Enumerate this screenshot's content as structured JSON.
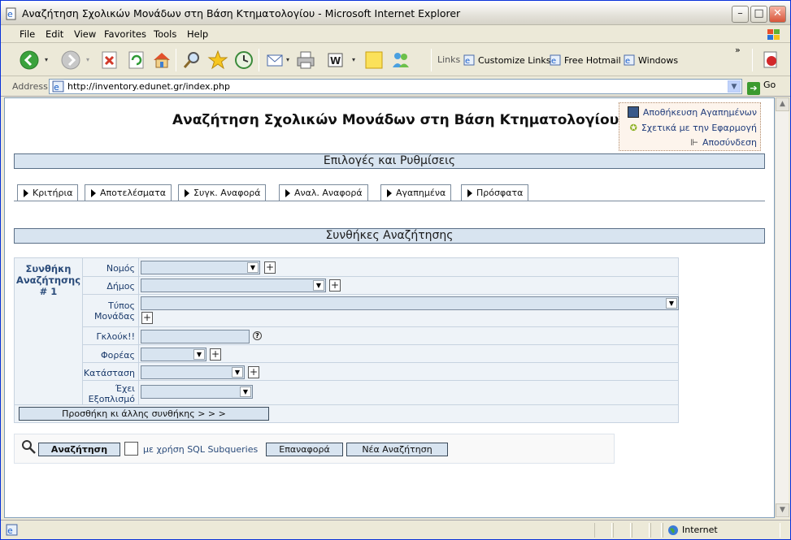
{
  "window": {
    "title": "Αναζήτηση Σχολικών Μονάδων στη Βάση Κτηματολογίου - Microsoft Internet Explorer"
  },
  "menu": [
    "File",
    "Edit",
    "View",
    "Favorites",
    "Tools",
    "Help"
  ],
  "links": {
    "label": "Links",
    "items": [
      "Customize Links",
      "Free Hotmail",
      "Windows"
    ]
  },
  "address": {
    "label": "Address",
    "url": "http://inventory.edunet.gr/index.php",
    "go": "Go"
  },
  "page": {
    "title": "Αναζήτηση Σχολικών Μονάδων στη Βάση Κτηματολογίου",
    "fav": {
      "save": "Αποθήκευση Αγαπημένων",
      "about": "Σχετικά με την Εφαρμογή",
      "logout": "Αποσύνδεση"
    },
    "options_header": "Επιλογές και Ρυθμίσεις",
    "tabs": [
      "Κριτήρια",
      "Αποτελέσματα",
      "Συγκ. Αναφορά",
      "Αναλ. Αναφορά",
      "Αγαπημένα",
      "Πρόσφατα"
    ],
    "conditions_header": "Συνθήκες Αναζήτησης",
    "condition_label": "Συνθήκη Αναζήτησης # 1",
    "fields": {
      "nomos": "Νομός",
      "dimos": "Δήμος",
      "typos1": "Τύπος",
      "typos2": "Μονάδας",
      "glouk": "Γκλούκ!!",
      "foreas": "Φορέας",
      "katastasi": "Κατάσταση",
      "exei1": "Έχει",
      "exei2": "Εξοπλισμό"
    },
    "add_condition": "Προσθήκη κι άλλης συνθήκης > > >",
    "search_button": "Αναζήτηση",
    "sql_label": "με χρήση SQL Subqueries",
    "reset_button": "Επαναφορά",
    "new_search_button": "Νέα Αναζήτηση"
  },
  "status": {
    "zone": "Internet"
  }
}
